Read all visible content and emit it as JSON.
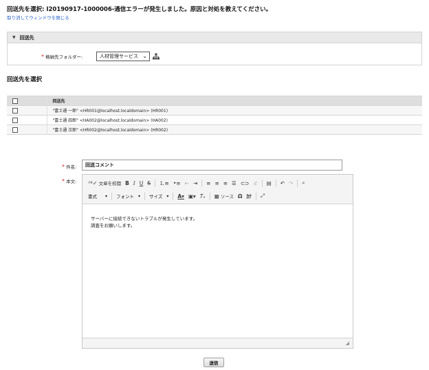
{
  "page": {
    "title": "回送先を選択: I20190917-1000006-通信エラーが発生しました。原因と対処を教えてください。",
    "close_link": "取り消してウィンドウを閉じる"
  },
  "destination_section": {
    "header": "回送先",
    "folder_label": "格納先フォルダー:",
    "folder_value": "人材管理サービス"
  },
  "select_title": "回送先を選択",
  "recipient_table": {
    "column_header": "回送先",
    "rows": [
      "\"富士通 一郎\" <HR001@localhost.localdomain> (HR001)",
      "\"富士通 四郎\" <HA002@localhost.localdomain> (HA002)",
      "\"富士通 次郎\" <HR002@localhost.localdomain> (HR002)"
    ]
  },
  "form": {
    "subject_label": "件名:",
    "subject_value": "回送コメント",
    "body_label": "本文:"
  },
  "editor": {
    "spellcheck_label": "文章を校閲",
    "format_combo": "書式",
    "font_combo": "フォント",
    "size_combo": "サイズ",
    "source_label": "ソース",
    "body_lines": [
      "サーバーに接続できないトラブルが発生しています。",
      "調査をお願いします。"
    ]
  },
  "send_button": "送信"
}
